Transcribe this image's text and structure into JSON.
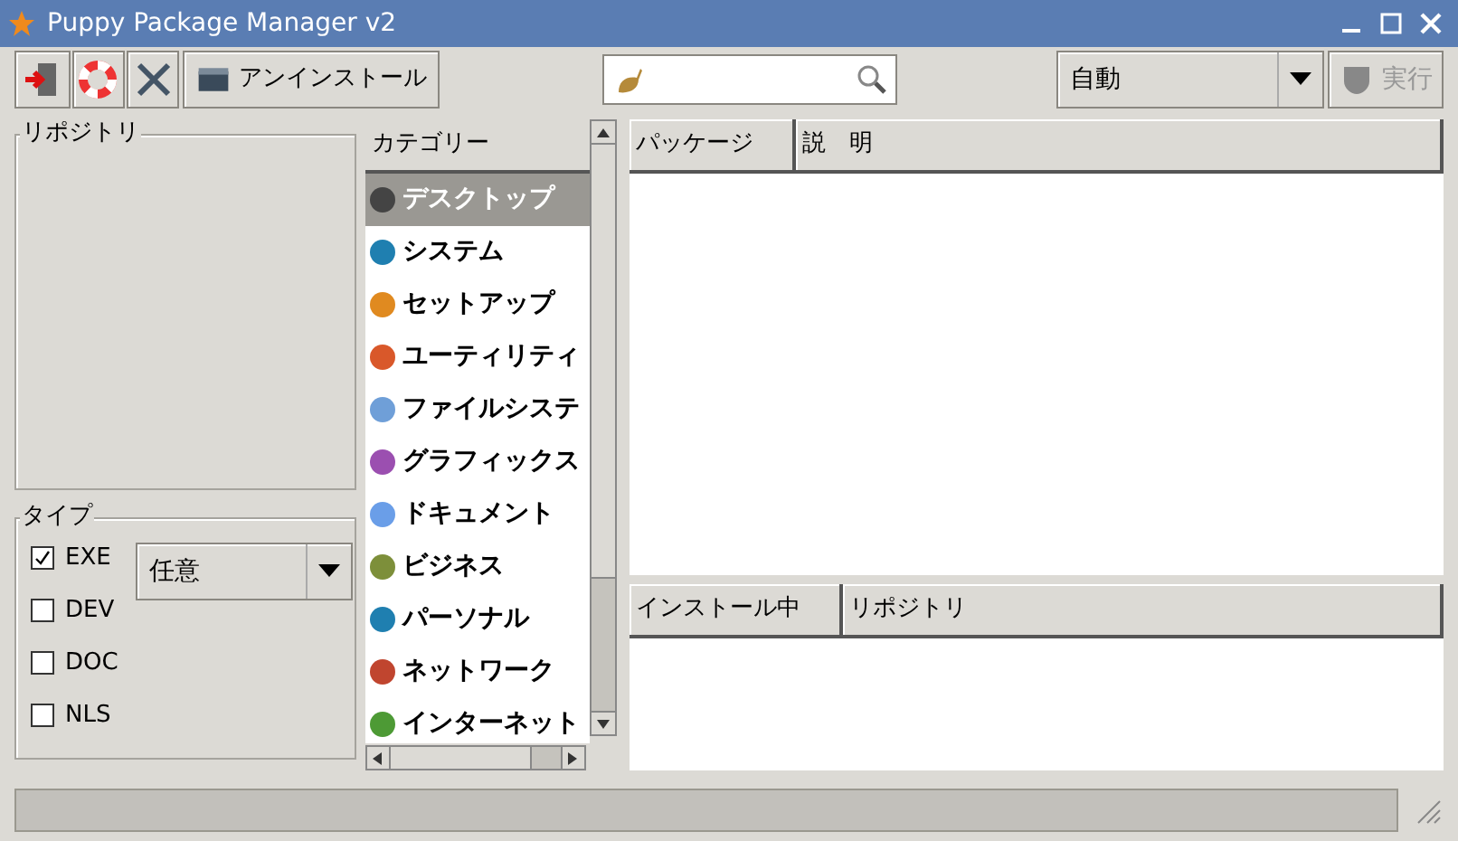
{
  "window": {
    "title": "Puppy Package Manager v2"
  },
  "toolbar": {
    "uninstall_button": "アンインストール",
    "mode_dropdown": "自動",
    "run_button": {
      "label": "実行",
      "disabled": true
    }
  },
  "repository_frame": {
    "title": "リポジトリ"
  },
  "type_frame": {
    "title": "タイプ",
    "types": [
      {
        "label": "EXE",
        "checked": true
      },
      {
        "label": "DEV",
        "checked": false
      },
      {
        "label": "DOC",
        "checked": false
      },
      {
        "label": "NLS",
        "checked": false
      }
    ],
    "dropdown": "任意"
  },
  "categories": {
    "header": "カテゴリー",
    "items": [
      {
        "label": "デスクトップ",
        "color": "#444444",
        "selected": true
      },
      {
        "label": "システム",
        "color": "#1f7fb0",
        "selected": false
      },
      {
        "label": "セットアップ",
        "color": "#e08a20",
        "selected": false
      },
      {
        "label": "ユーティリティ",
        "color": "#d9582a",
        "selected": false
      },
      {
        "label": "ファイルシステ",
        "color": "#6f9fd8",
        "selected": false
      },
      {
        "label": "グラフィックス",
        "color": "#9b4fb0",
        "selected": false
      },
      {
        "label": "ドキュメント",
        "color": "#6a9ee8",
        "selected": false
      },
      {
        "label": "ビジネス",
        "color": "#7d8f3a",
        "selected": false
      },
      {
        "label": "パーソナル",
        "color": "#1f7fb0",
        "selected": false
      },
      {
        "label": "ネットワーク",
        "color": "#c0452f",
        "selected": false
      },
      {
        "label": "インターネット",
        "color": "#4d9a35",
        "selected": false
      }
    ]
  },
  "packages_table": {
    "columns": [
      "パッケージ",
      "説　明"
    ]
  },
  "installing_table": {
    "columns": [
      "インストール中",
      "リポジトリ"
    ]
  }
}
